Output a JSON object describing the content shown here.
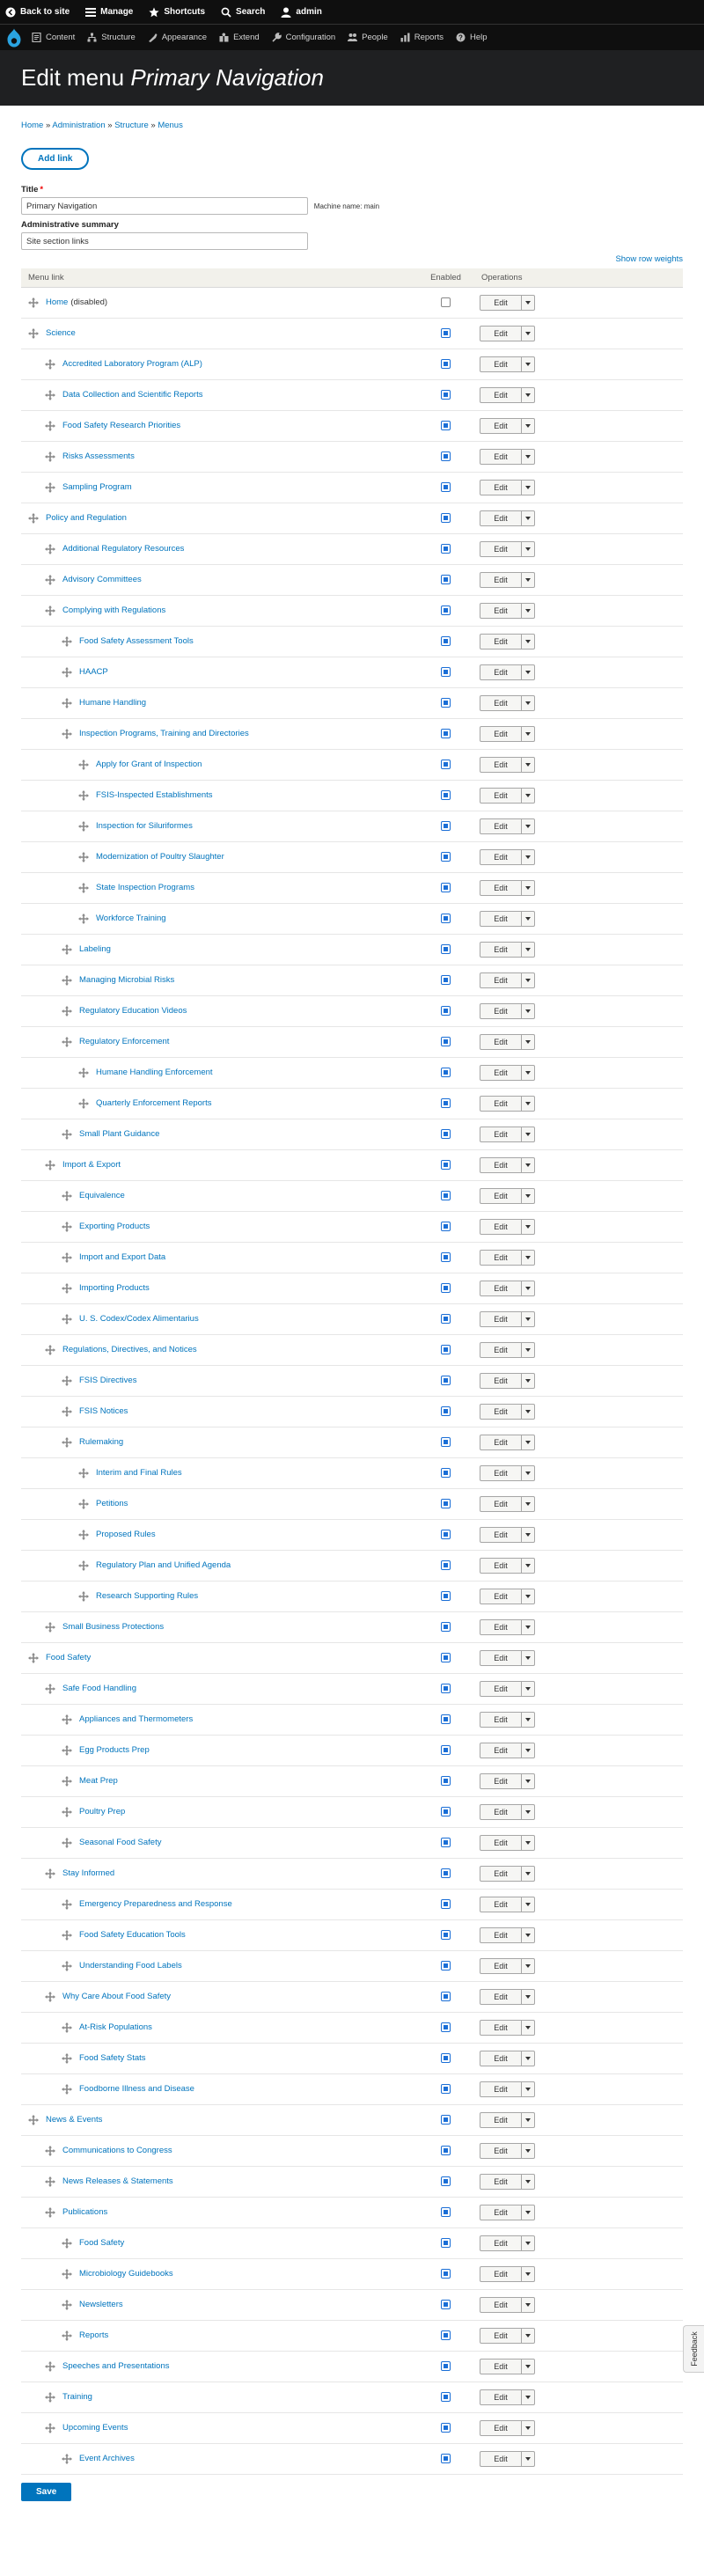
{
  "toolbar": {
    "back_to_site": "Back to site",
    "manage": "Manage",
    "shortcuts": "Shortcuts",
    "search": "Search",
    "user": "admin"
  },
  "tray": {
    "items": [
      "Content",
      "Structure",
      "Appearance",
      "Extend",
      "Configuration",
      "People",
      "Reports",
      "Help"
    ]
  },
  "header": {
    "title_prefix": "Edit menu",
    "title_menu": "Primary Navigation"
  },
  "breadcrumb": [
    "Home",
    "Administration",
    "Structure",
    "Menus"
  ],
  "breadcrumb_separator": "»",
  "actions": {
    "add_link": "Add link",
    "save": "Save"
  },
  "form": {
    "title_label": "Title",
    "title_value": "Primary Navigation",
    "machine_name": "Machine name: main",
    "summary_label": "Administrative summary",
    "summary_value": "Site section links"
  },
  "show_row_weights": "Show row weights",
  "table": {
    "headers": [
      "Menu link",
      "Enabled",
      "Operations"
    ],
    "edit_label": "Edit",
    "disabled_note": "(disabled)",
    "rows": [
      {
        "label": "Home",
        "depth": 0,
        "enabled": false
      },
      {
        "label": "Science",
        "depth": 0,
        "enabled": true
      },
      {
        "label": "Accredited Laboratory Program (ALP)",
        "depth": 1,
        "enabled": true
      },
      {
        "label": "Data Collection and Scientific Reports",
        "depth": 1,
        "enabled": true
      },
      {
        "label": "Food Safety Research Priorities",
        "depth": 1,
        "enabled": true
      },
      {
        "label": "Risks Assessments",
        "depth": 1,
        "enabled": true
      },
      {
        "label": "Sampling Program",
        "depth": 1,
        "enabled": true
      },
      {
        "label": "Policy and Regulation",
        "depth": 0,
        "enabled": true
      },
      {
        "label": "Additional Regulatory Resources",
        "depth": 1,
        "enabled": true
      },
      {
        "label": "Advisory Committees",
        "depth": 1,
        "enabled": true
      },
      {
        "label": "Complying with Regulations",
        "depth": 1,
        "enabled": true
      },
      {
        "label": "Food Safety Assessment Tools",
        "depth": 2,
        "enabled": true
      },
      {
        "label": "HAACP",
        "depth": 2,
        "enabled": true
      },
      {
        "label": "Humane Handling",
        "depth": 2,
        "enabled": true
      },
      {
        "label": "Inspection Programs, Training and Directories",
        "depth": 2,
        "enabled": true
      },
      {
        "label": "Apply for Grant of Inspection",
        "depth": 3,
        "enabled": true
      },
      {
        "label": "FSIS-Inspected Establishments",
        "depth": 3,
        "enabled": true
      },
      {
        "label": "Inspection for Siluriformes",
        "depth": 3,
        "enabled": true
      },
      {
        "label": "Modernization of Poultry Slaughter",
        "depth": 3,
        "enabled": true
      },
      {
        "label": "State Inspection Programs",
        "depth": 3,
        "enabled": true
      },
      {
        "label": "Workforce Training",
        "depth": 3,
        "enabled": true
      },
      {
        "label": "Labeling",
        "depth": 2,
        "enabled": true
      },
      {
        "label": "Managing Microbial Risks",
        "depth": 2,
        "enabled": true
      },
      {
        "label": "Regulatory Education Videos",
        "depth": 2,
        "enabled": true
      },
      {
        "label": "Regulatory Enforcement",
        "depth": 2,
        "enabled": true
      },
      {
        "label": "Humane Handling Enforcement",
        "depth": 3,
        "enabled": true
      },
      {
        "label": "Quarterly Enforcement Reports",
        "depth": 3,
        "enabled": true
      },
      {
        "label": "Small Plant Guidance",
        "depth": 2,
        "enabled": true
      },
      {
        "label": "Import & Export",
        "depth": 1,
        "enabled": true
      },
      {
        "label": "Equivalence",
        "depth": 2,
        "enabled": true
      },
      {
        "label": "Exporting Products",
        "depth": 2,
        "enabled": true
      },
      {
        "label": "Import and Export Data",
        "depth": 2,
        "enabled": true
      },
      {
        "label": "Importing Products",
        "depth": 2,
        "enabled": true
      },
      {
        "label": "U. S. Codex/Codex Alimentarius",
        "depth": 2,
        "enabled": true
      },
      {
        "label": "Regulations, Directives, and Notices",
        "depth": 1,
        "enabled": true
      },
      {
        "label": "FSIS Directives",
        "depth": 2,
        "enabled": true
      },
      {
        "label": "FSIS Notices",
        "depth": 2,
        "enabled": true
      },
      {
        "label": "Rulemaking",
        "depth": 2,
        "enabled": true
      },
      {
        "label": "Interim and Final Rules",
        "depth": 3,
        "enabled": true
      },
      {
        "label": "Petitions",
        "depth": 3,
        "enabled": true
      },
      {
        "label": "Proposed Rules",
        "depth": 3,
        "enabled": true
      },
      {
        "label": "Regulatory Plan and Unified Agenda",
        "depth": 3,
        "enabled": true
      },
      {
        "label": "Research Supporting Rules",
        "depth": 3,
        "enabled": true
      },
      {
        "label": "Small Business Protections",
        "depth": 1,
        "enabled": true
      },
      {
        "label": "Food Safety",
        "depth": 0,
        "enabled": true
      },
      {
        "label": "Safe Food Handling",
        "depth": 1,
        "enabled": true
      },
      {
        "label": "Appliances and Thermometers",
        "depth": 2,
        "enabled": true
      },
      {
        "label": "Egg Products Prep",
        "depth": 2,
        "enabled": true
      },
      {
        "label": "Meat Prep",
        "depth": 2,
        "enabled": true
      },
      {
        "label": "Poultry Prep",
        "depth": 2,
        "enabled": true
      },
      {
        "label": "Seasonal Food Safety",
        "depth": 2,
        "enabled": true
      },
      {
        "label": "Stay Informed",
        "depth": 1,
        "enabled": true
      },
      {
        "label": "Emergency Preparedness and Response",
        "depth": 2,
        "enabled": true
      },
      {
        "label": "Food Safety Education Tools",
        "depth": 2,
        "enabled": true
      },
      {
        "label": "Understanding Food Labels",
        "depth": 2,
        "enabled": true
      },
      {
        "label": "Why Care About Food Safety",
        "depth": 1,
        "enabled": true
      },
      {
        "label": "At-Risk Populations",
        "depth": 2,
        "enabled": true
      },
      {
        "label": "Food Safety Stats",
        "depth": 2,
        "enabled": true
      },
      {
        "label": "Foodborne Illness and Disease",
        "depth": 2,
        "enabled": true
      },
      {
        "label": "News & Events",
        "depth": 0,
        "enabled": true
      },
      {
        "label": "Communications to Congress",
        "depth": 1,
        "enabled": true
      },
      {
        "label": "News Releases & Statements",
        "depth": 1,
        "enabled": true
      },
      {
        "label": "Publications",
        "depth": 1,
        "enabled": true
      },
      {
        "label": "Food Safety",
        "depth": 2,
        "enabled": true
      },
      {
        "label": "Microbiology Guidebooks",
        "depth": 2,
        "enabled": true
      },
      {
        "label": "Newsletters",
        "depth": 2,
        "enabled": true
      },
      {
        "label": "Reports",
        "depth": 2,
        "enabled": true
      },
      {
        "label": "Speeches and Presentations",
        "depth": 1,
        "enabled": true
      },
      {
        "label": "Training",
        "depth": 1,
        "enabled": true
      },
      {
        "label": "Upcoming Events",
        "depth": 1,
        "enabled": true
      },
      {
        "label": "Event Archives",
        "depth": 2,
        "enabled": true
      }
    ]
  },
  "feedback": "Feedback",
  "colors": {
    "link": "#0074bd",
    "toolbar": "#0f0f0f",
    "header": "#1f2022",
    "checkbox": "#1a6ed6"
  },
  "icons": {
    "toolbar": [
      "back-arrow-icon",
      "hamburger-icon",
      "star-icon",
      "search-icon",
      "user-icon"
    ],
    "tray": [
      "content-icon",
      "structure-icon",
      "appearance-icon",
      "extend-icon",
      "configuration-icon",
      "people-icon",
      "reports-icon",
      "help-icon"
    ],
    "row": "drag-handle-icon"
  }
}
